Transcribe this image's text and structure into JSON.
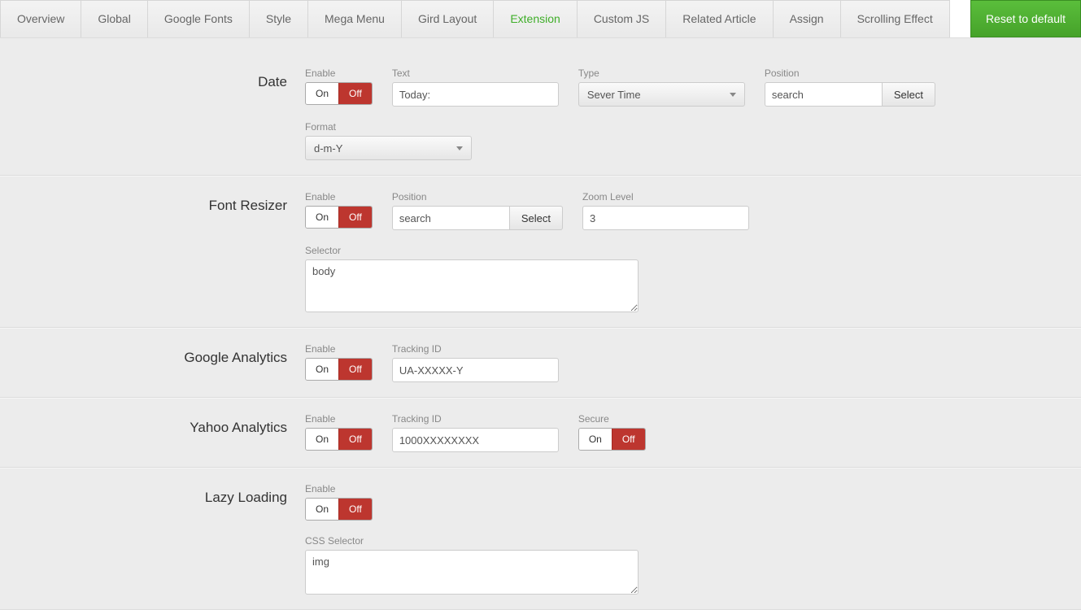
{
  "tabs": [
    "Overview",
    "Global",
    "Google Fonts",
    "Style",
    "Mega Menu",
    "Gird Layout",
    "Extension",
    "Custom JS",
    "Related Article",
    "Assign",
    "Scrolling Effect"
  ],
  "activeTab": "Extension",
  "resetLabel": "Reset to default",
  "common": {
    "enableLabel": "Enable",
    "on": "On",
    "off": "Off",
    "selectLabel": "Select",
    "positionLabel": "Position"
  },
  "date": {
    "title": "Date",
    "textLabel": "Text",
    "textValue": "Today:",
    "typeLabel": "Type",
    "typeValue": "Sever Time",
    "positionValue": "search",
    "formatLabel": "Format",
    "formatValue": "d-m-Y"
  },
  "fontResizer": {
    "title": "Font Resizer",
    "positionValue": "search",
    "zoomLabel": "Zoom Level",
    "zoomValue": "3",
    "selectorLabel": "Selector",
    "selectorValue": "body"
  },
  "googleAnalytics": {
    "title": "Google Analytics",
    "trackingLabel": "Tracking ID",
    "trackingValue": "UA-XXXXX-Y"
  },
  "yahooAnalytics": {
    "title": "Yahoo Analytics",
    "trackingLabel": "Tracking ID",
    "trackingValue": "1000XXXXXXXX",
    "secureLabel": "Secure"
  },
  "lazyLoading": {
    "title": "Lazy Loading",
    "cssSelectorLabel": "CSS Selector",
    "cssSelectorValue": "img"
  }
}
